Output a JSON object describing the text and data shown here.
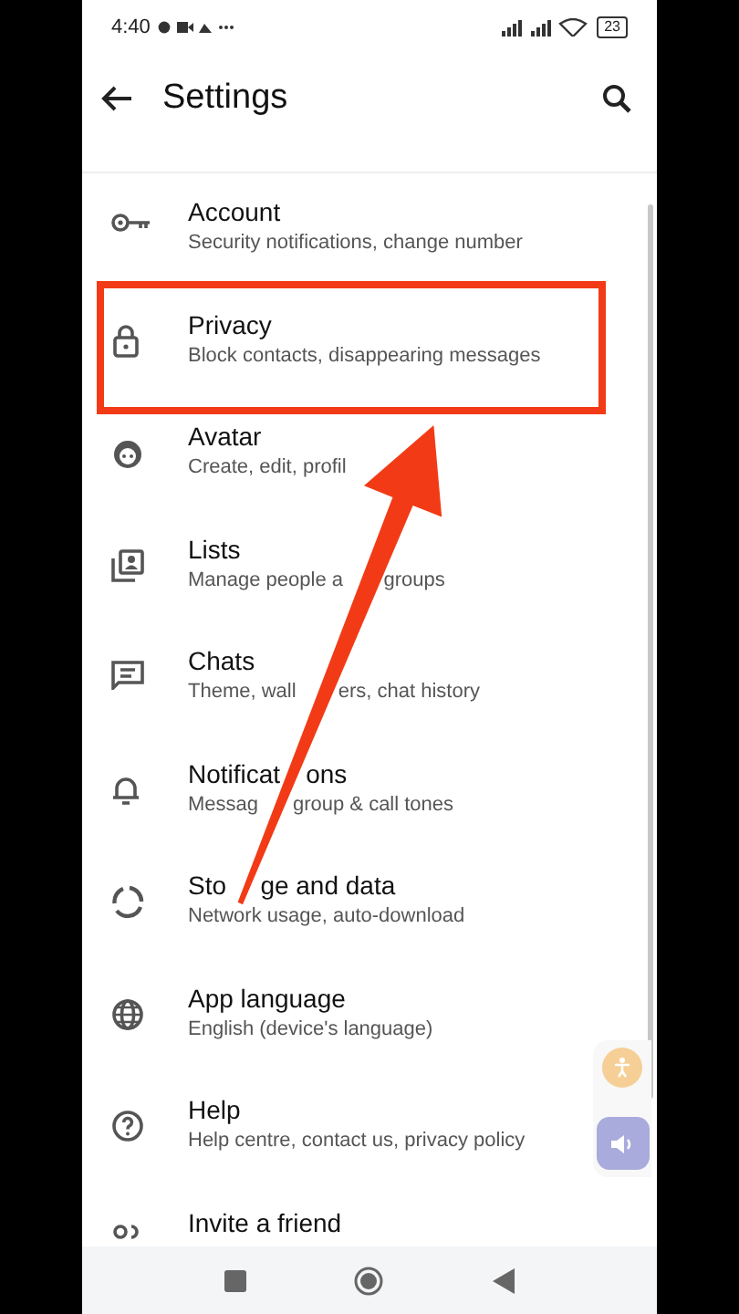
{
  "status_bar": {
    "time": "4:40",
    "battery": "23"
  },
  "header": {
    "title": "Settings"
  },
  "items": [
    {
      "title": [
        "Account"
      ],
      "subtitle": [
        "Security notifications, change number"
      ],
      "highlighted": false
    },
    {
      "title": [
        "Privacy"
      ],
      "subtitle": [
        "Block contacts, disappearing messages"
      ],
      "highlighted": true
    },
    {
      "title": [
        "Avatar"
      ],
      "subtitle": [
        "Create, edit, profil"
      ],
      "highlighted": false
    },
    {
      "title": [
        "Lists"
      ],
      "subtitle": [
        "Manage people a",
        "groups"
      ],
      "highlighted": false
    },
    {
      "title": [
        "Chats"
      ],
      "subtitle": [
        "Theme, wall",
        "ers, chat history"
      ],
      "highlighted": false
    },
    {
      "title": [
        "Notificat",
        "ons"
      ],
      "subtitle": [
        "Messag",
        "group & call tones"
      ],
      "highlighted": false
    },
    {
      "title": [
        "Sto",
        "ge and data"
      ],
      "subtitle": [
        "Network usage, auto-download"
      ],
      "highlighted": false
    },
    {
      "title": [
        "App language"
      ],
      "subtitle": [
        "English (device's language)"
      ],
      "highlighted": false
    },
    {
      "title": [
        "Help"
      ],
      "subtitle": [
        "Help centre, contact us, privacy policy"
      ],
      "highlighted": false
    },
    {
      "title": [
        "Invite a friend"
      ],
      "highlighted": false
    }
  ]
}
